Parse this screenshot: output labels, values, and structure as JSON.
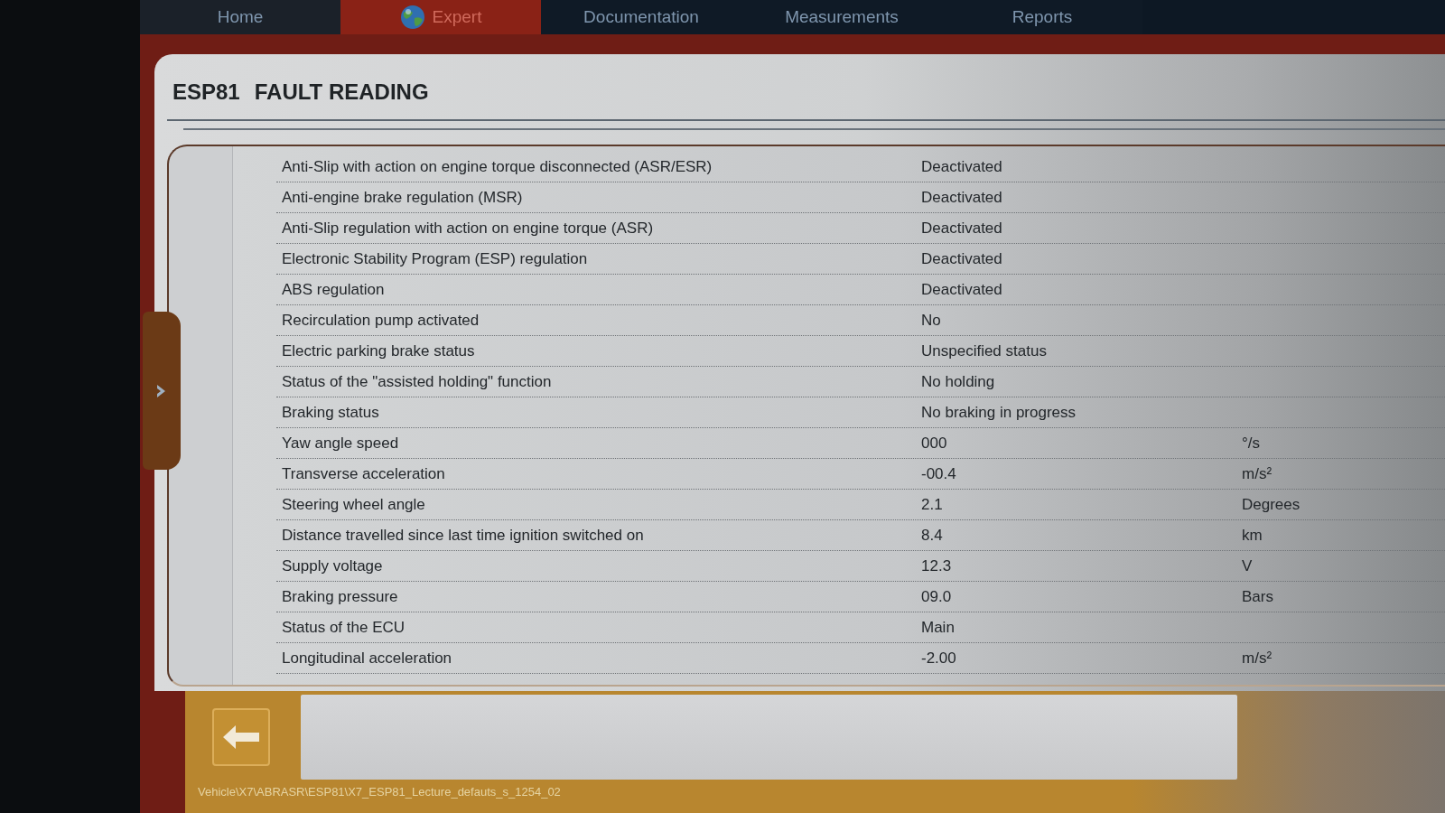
{
  "nav_tabs": [
    {
      "label": "Home",
      "selected": false
    },
    {
      "label": "Expert",
      "selected": true
    },
    {
      "label": "Documentation",
      "selected": false
    },
    {
      "label": "Measurements",
      "selected": false
    },
    {
      "label": "Reports",
      "selected": false
    }
  ],
  "page_title": {
    "ecu": "ESP81",
    "title": "FAULT READING"
  },
  "parameters": [
    {
      "name": "Anti-Slip with action on engine torque disconnected (ASR/ESR)",
      "value": "Deactivated"
    },
    {
      "name": "Anti-engine brake regulation (MSR)",
      "value": "Deactivated"
    },
    {
      "name": "Anti-Slip regulation with action on engine torque (ASR)",
      "value": "Deactivated"
    },
    {
      "name": "Electronic Stability Program (ESP) regulation",
      "value": "Deactivated"
    },
    {
      "name": "ABS regulation",
      "value": "Deactivated"
    },
    {
      "name": "Recirculation pump activated",
      "value": "No"
    },
    {
      "name": "Electric parking brake status",
      "value": "Unspecified status"
    },
    {
      "name": "Status of the \"assisted holding\" function",
      "value": "No holding"
    },
    {
      "name": "Braking status",
      "value": "No braking in progress"
    },
    {
      "name": "Yaw angle speed",
      "value": "000",
      "unit": "°/s"
    },
    {
      "name": "Transverse acceleration",
      "value": "-00.4",
      "unit": "m/s²"
    },
    {
      "name": "Steering wheel angle",
      "value": "2.1",
      "unit": "Degrees"
    },
    {
      "name": "Distance travelled since last time ignition switched on",
      "value": "8.4",
      "unit": "km"
    },
    {
      "name": "Supply voltage",
      "value": "12.3",
      "unit": "V"
    },
    {
      "name": "Braking pressure",
      "value": "09.0",
      "unit": "Bars"
    },
    {
      "name": "Status of the ECU",
      "value": "Main"
    },
    {
      "name": "Longitudinal acceleration",
      "value": "-2.00",
      "unit": "m/s²"
    }
  ],
  "status_bar": "Vehicle\\X7\\ABRASR\\ESP81\\X7_ESP81_Lecture_defauts_s_1254_02"
}
